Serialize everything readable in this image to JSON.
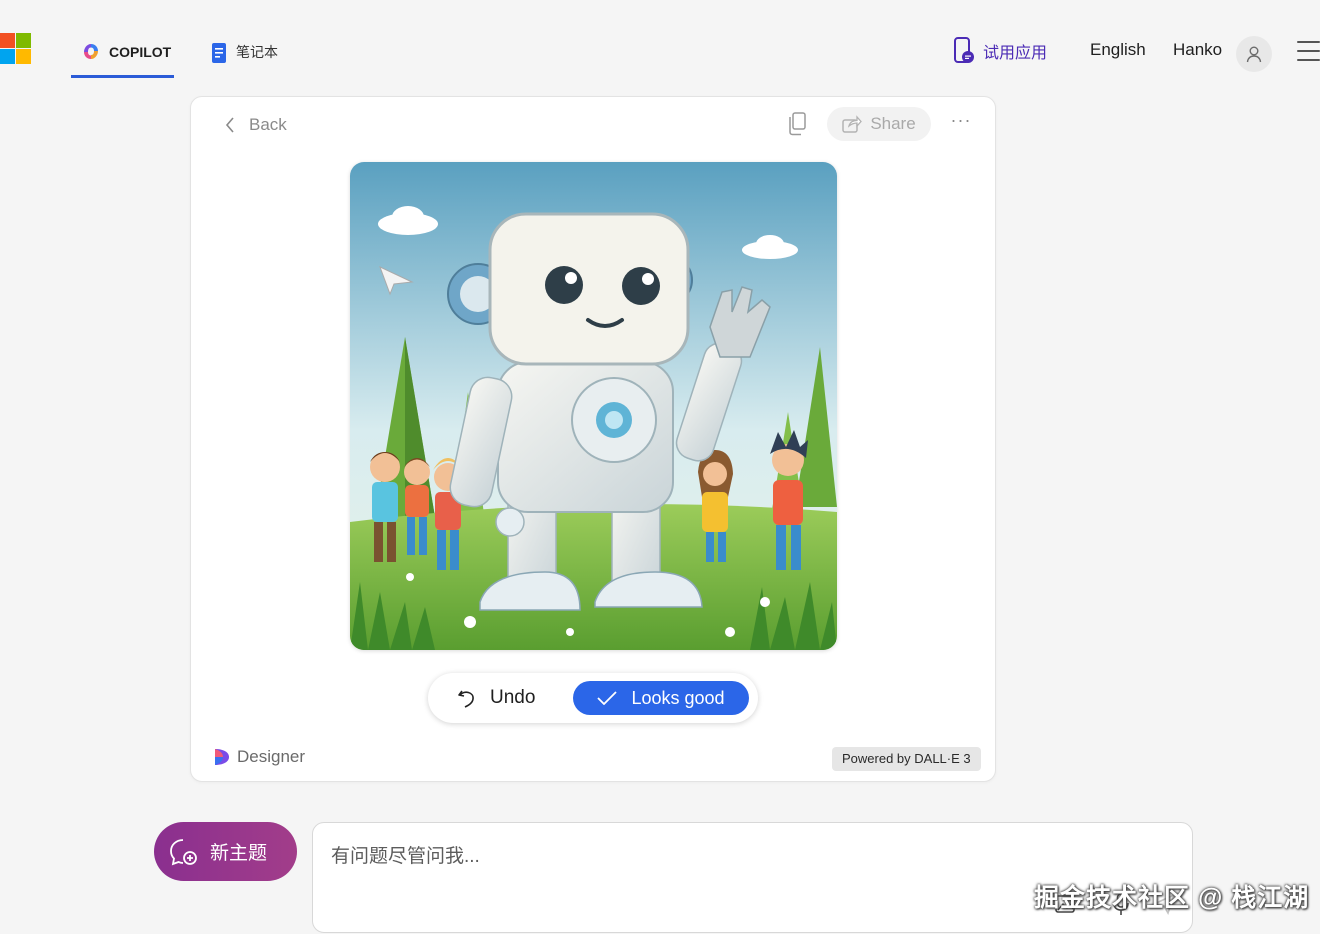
{
  "header": {
    "tabs": [
      {
        "label": "COPILOT",
        "active": true
      },
      {
        "label": "笔记本",
        "active": false
      }
    ],
    "try_app": "试用应用",
    "language": "English",
    "user_name": "Hanko"
  },
  "card": {
    "back_label": "Back",
    "share_label": "Share",
    "more_label": "···",
    "image_alt": "robot-waving-with-children-in-meadow",
    "undo_label": "Undo",
    "looks_good_label": "Looks good",
    "designer_label": "Designer",
    "powered_by": "Powered by DALL·E 3"
  },
  "composer": {
    "new_topic_label": "新主题",
    "placeholder": "有问题尽管问我..."
  },
  "watermark": "掘金技术社区 @ 栈江湖",
  "colors": {
    "accent_blue": "#2b66e8",
    "tab_underline": "#2b5bd7",
    "new_topic_gradient": [
      "#8a2f8f",
      "#a23d8a"
    ],
    "try_app_purple": "#4b2bb5"
  }
}
